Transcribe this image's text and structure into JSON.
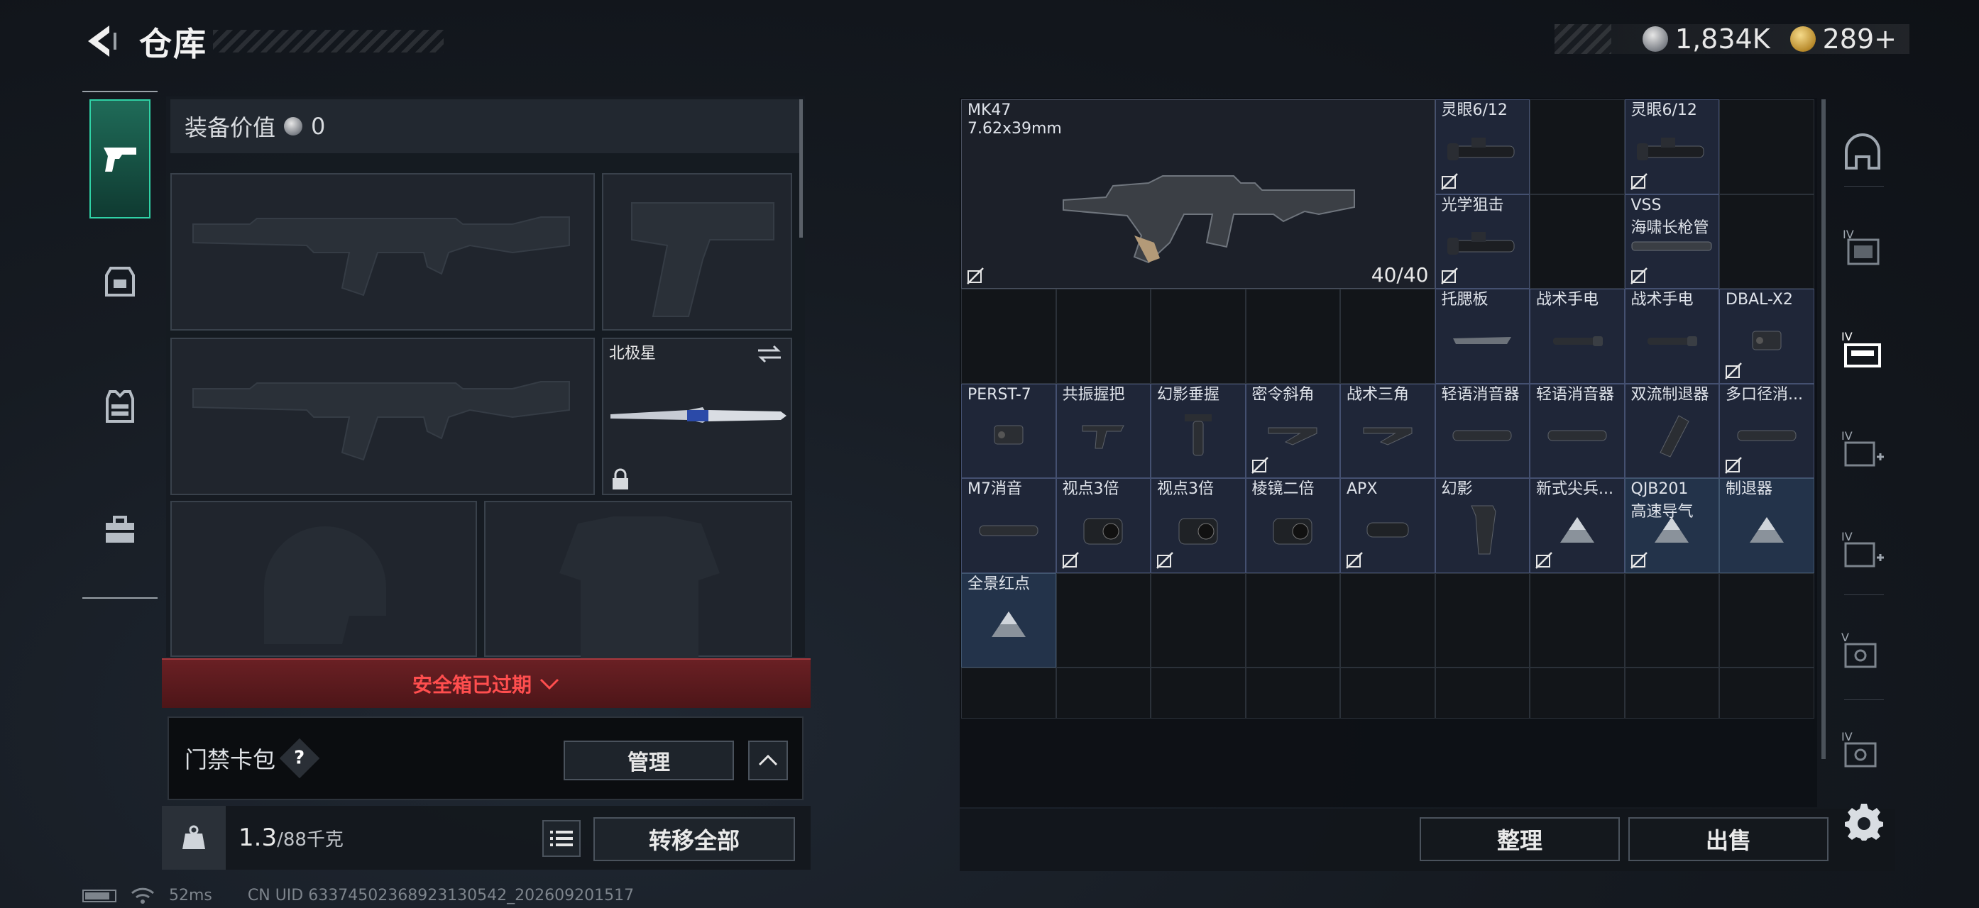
{
  "header": {
    "title": "仓库",
    "currency": [
      {
        "icon": "silver-coin-icon",
        "value": "1,834K"
      },
      {
        "icon": "gold-coin-icon",
        "value": "289+"
      }
    ]
  },
  "left_nav": [
    {
      "icon": "pistol-icon",
      "active": true
    },
    {
      "icon": "backpack-icon",
      "active": false
    },
    {
      "icon": "vest-icon",
      "active": false
    },
    {
      "icon": "toolbox-icon",
      "active": false
    }
  ],
  "loadout": {
    "equip_value_label": "装备价值",
    "equip_value": "0",
    "melee_name": "北极星",
    "safe_box_text": "安全箱已过期",
    "keycard_label": "门禁卡包",
    "keycard_help": "?",
    "manage_label": "管理",
    "weight_value": "1.3",
    "weight_max": "/88千克",
    "transfer_label": "转移全部"
  },
  "status": {
    "ping": "52ms",
    "uid": "CN UID 63374502368923130542_202609201517"
  },
  "storage": {
    "items": [
      {
        "name": "MK47",
        "sub": "7.62x39mm",
        "ammo": "40/40"
      },
      {
        "name": "灵眼6/12"
      },
      {
        "name": "灵眼6/12"
      },
      {
        "name": "光学狙击"
      },
      {
        "name": "VSS",
        "sub": "海啸长枪管"
      },
      {
        "name": "托腮板"
      },
      {
        "name": "战术手电"
      },
      {
        "name": "战术手电"
      },
      {
        "name": "DBAL-X2"
      },
      {
        "name": "PERST-7"
      },
      {
        "name": "共振握把"
      },
      {
        "name": "幻影垂握"
      },
      {
        "name": "密令斜角"
      },
      {
        "name": "战术三角"
      },
      {
        "name": "轻语消音器"
      },
      {
        "name": "轻语消音器"
      },
      {
        "name": "双流制退器"
      },
      {
        "name": "多口径消..."
      },
      {
        "name": "M7消音"
      },
      {
        "name": "视点3倍"
      },
      {
        "name": "视点3倍"
      },
      {
        "name": "棱镜二倍"
      },
      {
        "name": "APX"
      },
      {
        "name": "幻影"
      },
      {
        "name": "新式尖兵..."
      },
      {
        "name": "QJB201",
        "sub": "高速导气"
      },
      {
        "name": "制退器"
      },
      {
        "name": "全景红点"
      }
    ],
    "sort_label": "整理",
    "sell_label": "出售"
  },
  "right_nav": [
    {
      "icon": "helmet-storage-icon"
    },
    {
      "icon": "tier4-case-icon"
    },
    {
      "icon": "tier4-weapon-storage-icon",
      "active": true
    },
    {
      "icon": "tier4-med-storage-icon"
    },
    {
      "icon": "tier4-med-storage-2-icon"
    },
    {
      "icon": "tier5-ammo-storage-icon"
    },
    {
      "icon": "tier4-ammo-storage-icon"
    },
    {
      "icon": "settings-gear-icon"
    }
  ]
}
